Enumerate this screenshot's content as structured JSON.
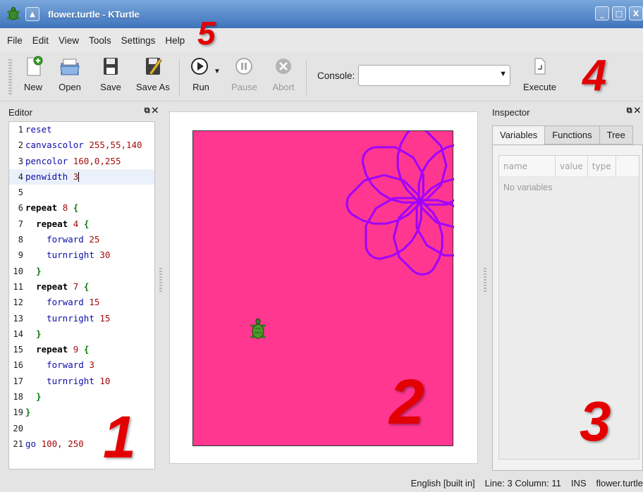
{
  "window": {
    "title": "flower.turtle - KTurtle",
    "controls": [
      "_",
      "□",
      "X"
    ]
  },
  "menubar": {
    "items": [
      "File",
      "Edit",
      "View",
      "Tools",
      "Settings",
      "Help"
    ]
  },
  "toolbar": {
    "new": "New",
    "open": "Open",
    "save": "Save",
    "save_as": "Save As",
    "run": "Run",
    "pause": "Pause",
    "abort": "Abort",
    "console_label": "Console:",
    "console_value": "",
    "execute": "Execute"
  },
  "annotations": [
    "1",
    "2",
    "3",
    "4",
    "5"
  ],
  "editor": {
    "title": "Editor",
    "lines": [
      {
        "n": "1",
        "text": "reset"
      },
      {
        "n": "2",
        "text": "canvascolor 255,55,140"
      },
      {
        "n": "3",
        "text": "pencolor 160,0,255"
      },
      {
        "n": "4",
        "text": "penwidth 3"
      },
      {
        "n": "5",
        "text": ""
      },
      {
        "n": "6",
        "text": "repeat 8 {"
      },
      {
        "n": "7",
        "text": "  repeat 4 {"
      },
      {
        "n": "8",
        "text": "    forward 25"
      },
      {
        "n": "9",
        "text": "    turnright 30"
      },
      {
        "n": "10",
        "text": "  }"
      },
      {
        "n": "11",
        "text": "  repeat 7 {"
      },
      {
        "n": "12",
        "text": "    forward 15"
      },
      {
        "n": "13",
        "text": "    turnright 15"
      },
      {
        "n": "14",
        "text": "  }"
      },
      {
        "n": "15",
        "text": "  repeat 9 {"
      },
      {
        "n": "16",
        "text": "    forward 3"
      },
      {
        "n": "17",
        "text": "    turnright 10"
      },
      {
        "n": "18",
        "text": "  }"
      },
      {
        "n": "19",
        "text": "}"
      },
      {
        "n": "20",
        "text": ""
      },
      {
        "n": "21",
        "text": "go 100, 250"
      }
    ]
  },
  "canvas": {
    "background_color": "#ff3790",
    "pen_color": "#a000ff"
  },
  "inspector": {
    "title": "Inspector",
    "tabs": [
      "Variables",
      "Functions",
      "Tree"
    ],
    "columns": [
      "name",
      "value",
      "type"
    ],
    "empty_text": "No variables"
  },
  "statusbar": {
    "language": "English [built in]",
    "position": "Line: 3 Column: 11",
    "mode": "INS",
    "file": "flower.turtle"
  },
  "colors": {
    "title_bar": "#4a7fc4",
    "annotation": "#e30000",
    "keyword": "#0d0da8",
    "number": "#a60a0a",
    "bracket": "#0a7a0a"
  }
}
